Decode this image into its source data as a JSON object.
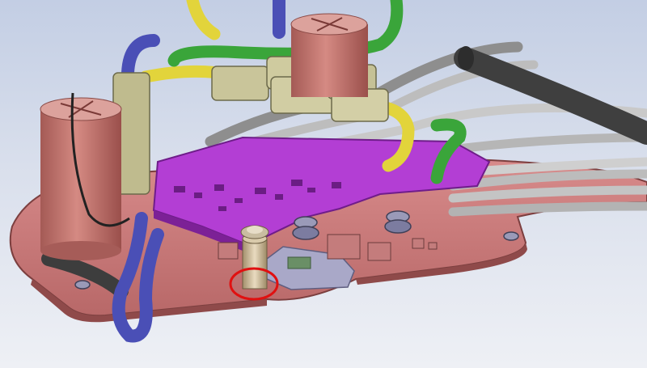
{
  "viewport": {
    "background_top": "#c3cee4",
    "background_bottom": "#eef0f5"
  },
  "colors": {
    "base_plate": "#c97878",
    "base_plate_edge": "#8c4b4b",
    "pcb": "#b73bd6",
    "pcb_edge": "#7c1f96",
    "capacitor": "#c77b74",
    "capacitor_top": "#dca29c",
    "cable_grey": "#b9b9b9",
    "cable_dark": "#4a4a4a",
    "cable_yellow": "#e3d43a",
    "cable_green": "#3ea63a",
    "cable_blue": "#4b4fb5",
    "connector": "#c9c59a",
    "standoff": "#d8c7a6",
    "sensor_bracket": "#a9a8c6",
    "highlight_circle": "#e01010"
  },
  "parts": {
    "annotation": "red-circle-highlight",
    "highlighted_part": "standoff-spacer"
  }
}
